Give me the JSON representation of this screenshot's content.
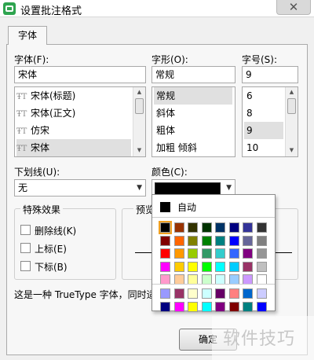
{
  "window": {
    "title": "设置批注格式",
    "close_glyph": "✕"
  },
  "tabs": [
    {
      "label": "字体",
      "active": true
    }
  ],
  "font": {
    "label": "字体(F):",
    "value": "宋体",
    "items": [
      "宋体(标题)",
      "宋体(正文)",
      "仿宋",
      "宋体"
    ],
    "selected_index": 3
  },
  "style": {
    "label": "字形(O):",
    "value": "常规",
    "items": [
      "常规",
      "斜体",
      "粗体",
      "加粗 倾斜"
    ],
    "selected_index": 0
  },
  "size": {
    "label": "字号(S):",
    "value": "9",
    "items": [
      "6",
      "8",
      "9",
      "10"
    ],
    "selected_index": 2
  },
  "underline": {
    "label": "下划线(U):",
    "value": "无"
  },
  "color": {
    "label": "颜色(C):",
    "value": "#000000"
  },
  "effects": {
    "title": "特殊效果",
    "options": [
      {
        "label": "删除线(K)",
        "checked": false
      },
      {
        "label": "上标(E)",
        "checked": false
      },
      {
        "label": "下标(B)",
        "checked": false
      }
    ]
  },
  "preview": {
    "title": "预览"
  },
  "info_text": "这是一种 TrueType 字体，同时适",
  "buttons": {
    "ok": "确定"
  },
  "palette": {
    "auto_label": "自动",
    "grid": [
      [
        "#000000",
        "#993300",
        "#333300",
        "#003300",
        "#003366",
        "#000080",
        "#333399",
        "#333333"
      ],
      [
        "#800000",
        "#ff6600",
        "#808000",
        "#008000",
        "#008080",
        "#0000ff",
        "#666699",
        "#808080"
      ],
      [
        "#ff0000",
        "#ff9900",
        "#99cc00",
        "#339966",
        "#33cccc",
        "#3366ff",
        "#800080",
        "#969696"
      ],
      [
        "#ff00ff",
        "#ffcc00",
        "#ffff00",
        "#00ff00",
        "#00ffff",
        "#00ccff",
        "#993366",
        "#c0c0c0"
      ],
      [
        "#ff99cc",
        "#ffcc99",
        "#ffff99",
        "#ccffcc",
        "#ccffff",
        "#99ccff",
        "#cc99ff",
        "#ffffff"
      ]
    ],
    "extra": [
      [
        "#9999ff",
        "#993366",
        "#ffffcc",
        "#ccffff",
        "#660066",
        "#ff8080",
        "#0066cc",
        "#ccccff"
      ],
      [
        "#000080",
        "#ff00ff",
        "#ffff00",
        "#00ffff",
        "#800080",
        "#800000",
        "#008080",
        "#0000ff"
      ]
    ],
    "selected": "#000000"
  },
  "watermark": "软件技巧"
}
